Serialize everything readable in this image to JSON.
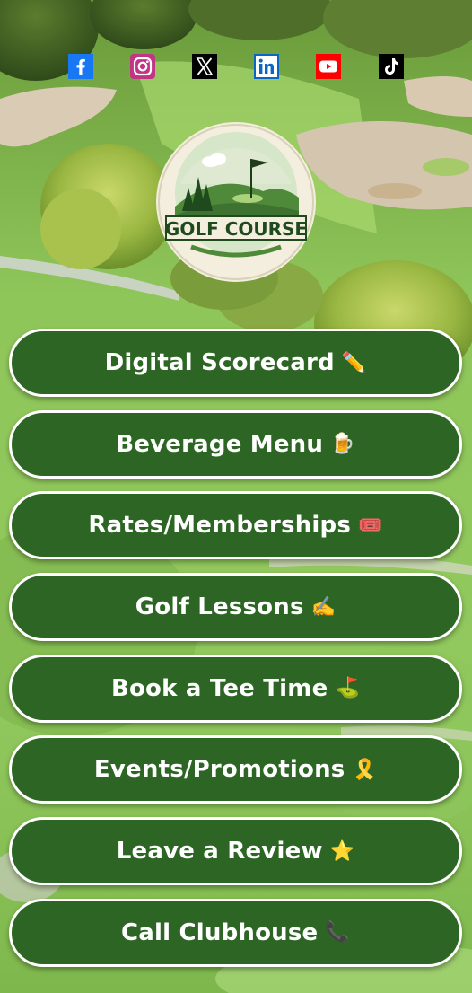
{
  "social": [
    {
      "name": "facebook-icon",
      "color": "#1877f2"
    },
    {
      "name": "instagram-icon",
      "color": "#c13584"
    },
    {
      "name": "x-icon",
      "color": "#000000"
    },
    {
      "name": "linkedin-icon",
      "color": "#0a66c2"
    },
    {
      "name": "youtube-icon",
      "color": "#ff0000"
    },
    {
      "name": "tiktok-icon",
      "color": "#000000"
    }
  ],
  "logo": {
    "text": "GOLF COURSE"
  },
  "links": [
    {
      "label": "Digital Scorecard",
      "emoji": "✏️"
    },
    {
      "label": "Beverage Menu",
      "emoji": "🍺"
    },
    {
      "label": "Rates/Memberships",
      "emoji": "🎟️"
    },
    {
      "label": "Golf Lessons",
      "emoji": "✍️"
    },
    {
      "label": "Book a Tee Time",
      "emoji": "⛳"
    },
    {
      "label": "Events/Promotions",
      "emoji": "🎗️"
    },
    {
      "label": "Leave a Review",
      "emoji": "⭐"
    },
    {
      "label": "Call Clubhouse",
      "emoji": "📞"
    }
  ],
  "colors": {
    "button_bg": "#2d6624",
    "button_border": "#ffffff",
    "button_text": "#ffffff"
  }
}
